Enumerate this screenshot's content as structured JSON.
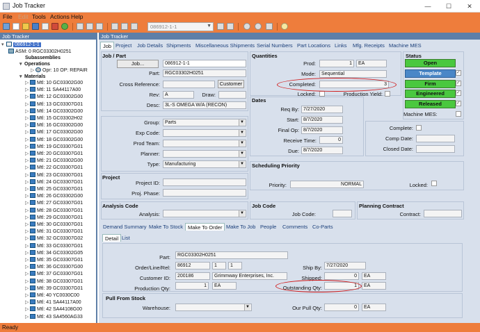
{
  "window": {
    "title": "Job Tracker",
    "min": "—",
    "max": "☐",
    "close": "✕"
  },
  "menu": [
    {
      "label": "File",
      "enabled": true
    },
    {
      "label": "Edit",
      "enabled": false
    },
    {
      "label": "Tools",
      "enabled": true
    },
    {
      "label": "Actions",
      "enabled": true
    },
    {
      "label": "Help",
      "enabled": true
    }
  ],
  "toolbar": {
    "job_combo": "086912-1-1"
  },
  "tree": {
    "header": "Job Tracker",
    "root": "086912-1-1",
    "asm": "ASM: 0 RGC03302H0251",
    "subassemblies": "Subassemblies",
    "operations": "Operations",
    "opr": "Opr: 10 OP: REPAIR",
    "materials": "Materials",
    "mtl": [
      "Mtl: 10 GC03302G00",
      "Mtl: 11 SA44117A00",
      "Mtl: 12 GC03302G00",
      "Mtl: 13 GC03307G01",
      "Mtl: 14 GC03302G00",
      "Mtl: 15 GC03302H02",
      "Mtl: 16 GC03302G00",
      "Mtl: 17 GC03302G00",
      "Mtl: 18 GC03302G00",
      "Mtl: 19 GC03307G01",
      "Mtl: 20 GC03307G01",
      "Mtl: 21 GC03302G00",
      "Mtl: 22 GC03307G01",
      "Mtl: 23 GC03307G01",
      "Mtl: 24 GC03307G01",
      "Mtl: 25 GC03307G01",
      "Mtl: 26 GC03302G00",
      "Mtl: 27 GC03307G01",
      "Mtl: 28 GC03307G01",
      "Mtl: 29 GC03307G01",
      "Mtl: 30 GC03307G01",
      "Mtl: 31 GC03307G01",
      "Mtl: 32 GC03307G02",
      "Mtl: 33 GC03307G01",
      "Mtl: 34 GC03302G05",
      "Mtl: 35 GC03307G01",
      "Mtl: 36 GC03307G00",
      "Mtl: 37 GC03307G01",
      "Mtl: 38 GC03307G01",
      "Mtl: 39 GC03307G01",
      "Mtl: 40 YC0030C00",
      "Mtl: 41 SA44117A00",
      "Mtl: 42 SA44108G00",
      "Mtl: 43 SA4560AG33"
    ]
  },
  "main_header": "Job Tracker",
  "tabs": [
    "Job",
    "Project",
    "Job Details",
    "Shipments",
    "Miscellaneous Shipments",
    "Serial Numbers",
    "Part Locations",
    "Links",
    "Mfg. Receipts",
    "Machine MES"
  ],
  "job_part": {
    "title": "Job / Part",
    "job_button": "Job...",
    "job": "086912-1-1",
    "part_label": "Part:",
    "part": "RGC03302H0251",
    "xref_label": "Cross Reference:",
    "xref": "",
    "customer_btn": "Customer",
    "rev_label": "Rev:",
    "rev": "A",
    "draw_label": "Draw:",
    "draw": "",
    "desc_label": "Desc:",
    "desc": "3L-S OMEGA W/A (RECON)"
  },
  "quantities": {
    "title": "Quantities",
    "prod_label": "Prod:",
    "prod": "1",
    "prod_uom": "EA",
    "mode_label": "Mode:",
    "mode": "Sequential",
    "completed_label": "Completed:",
    "completed": "3",
    "locked_label": "Locked:",
    "prod_yield_label": "Production Yield:"
  },
  "status": {
    "title": "Status",
    "open": "Open",
    "template": "Template",
    "firm": "Firm",
    "engineered": "Engineered",
    "released": "Released",
    "machine_mes_label": "Machine MES:"
  },
  "dates": {
    "title": "Dates",
    "req_by_label": "Req By:",
    "req_by": "7/27/2020",
    "start_label": "Start:",
    "start": "8/7/2020",
    "final_op_label": "Final Op:",
    "final_op": "8/7/2020",
    "receive_time_label": "Receive Time:",
    "receive_time": "0",
    "due_label": "Due:",
    "due": "8/7/2020",
    "complete_label": "Complete:",
    "comp_date_label": "Comp Date:",
    "closed_date_label": "Closed Date:"
  },
  "group": {
    "group_label": "Group:",
    "group": "Parts",
    "exp_code_label": "Exp Code:",
    "exp_code": "",
    "prod_team_label": "Prod Team:",
    "prod_team": "",
    "planner_label": "Planner:",
    "planner": "",
    "type_label": "Type:",
    "type": "Manufacturing"
  },
  "scheduling": {
    "title": "Scheduling Priority",
    "priority_label": "Priority:",
    "priority": "NORMAL",
    "locked_label": "Locked:"
  },
  "project": {
    "title": "Project",
    "project_id_label": "Project ID:",
    "proj_phase_label": "Proj. Phase:"
  },
  "analysis": {
    "title": "Analysis Code",
    "analysis_label": "Analysis:"
  },
  "job_code": {
    "title": "Job Code",
    "job_code_label": "Job Code:"
  },
  "planning": {
    "title": "Planning Contract",
    "contract_label": "Contract:"
  },
  "subtabs": [
    "Demand Summary",
    "Make To Stock",
    "Make To Order",
    "Make To Job",
    "People",
    "Comments",
    "Co-Parts"
  ],
  "detail_tabs": [
    "Detail",
    "List"
  ],
  "mto": {
    "part_label": "Part:",
    "part": "RGC03302H0251",
    "order_label": "Order/Line/Rel:",
    "order": "86912",
    "line": "1",
    "rel": "1",
    "customer_id_label": "Customer ID:",
    "customer_id": "200186",
    "customer_name": "Grimmway Enterprises, Inc.",
    "production_qty_label": "Production Qty:",
    "production_qty": "1",
    "production_uom": "EA",
    "ship_by_label": "Ship By:",
    "ship_by": "7/27/2020",
    "shipped_label": "Shipped:",
    "shipped": "0",
    "shipped_uom": "EA",
    "outstanding_label": "Outstanding Qty:",
    "outstanding": "1",
    "outstanding_uom": "EA",
    "pull_title": "Pull From Stock",
    "warehouse_label": "Warehouse:",
    "warehouse": "",
    "our_pull_label": "Our Pull Qty:",
    "our_pull": "0",
    "our_pull_uom": "EA"
  },
  "statusbar": "Ready",
  "colors": {
    "accent": "#ee7d3c",
    "tree_selection": "#3f6fc8",
    "annotation": "#d01a1a",
    "status_green": "#4ac83f"
  }
}
